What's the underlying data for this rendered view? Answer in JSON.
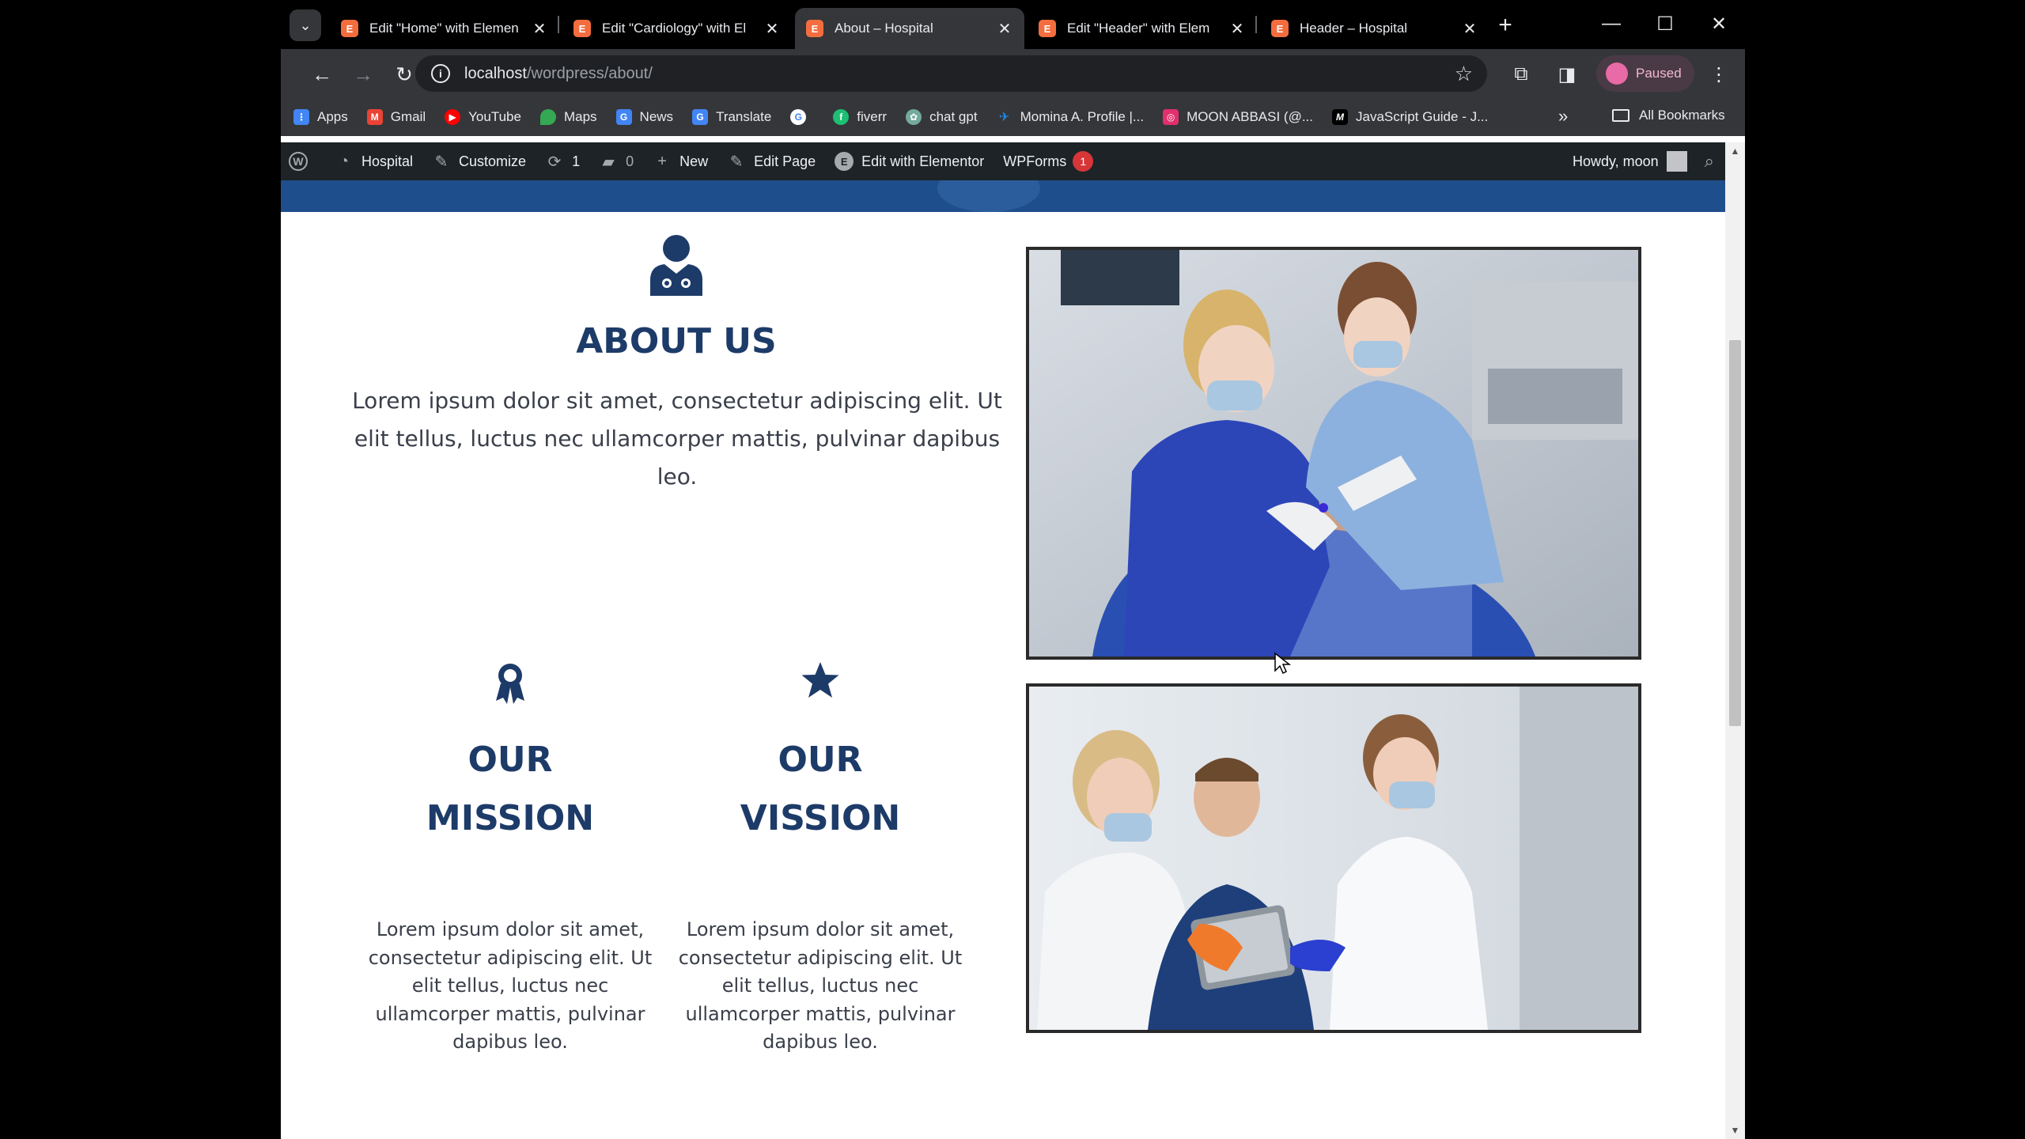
{
  "browser": {
    "tabs": [
      {
        "title": "Edit \"Home\" with Elemen",
        "active": false
      },
      {
        "title": "Edit \"Cardiology\" with El",
        "active": false
      },
      {
        "title": "About – Hospital",
        "active": true
      },
      {
        "title": "Edit \"Header\" with Elem",
        "active": false
      },
      {
        "title": "Header – Hospital",
        "active": false
      }
    ],
    "url_host": "localhost",
    "url_path": "/wordpress/about/",
    "profile_label": "Paused",
    "bookmarks": [
      {
        "label": "Apps",
        "icon": "apps-grid-icon",
        "color": "#4285f4"
      },
      {
        "label": "Gmail",
        "icon": "gmail-icon",
        "color": "#ea4335"
      },
      {
        "label": "YouTube",
        "icon": "youtube-icon",
        "color": "#ff0000"
      },
      {
        "label": "Maps",
        "icon": "maps-icon",
        "color": "#34a853"
      },
      {
        "label": "News",
        "icon": "news-icon",
        "color": "#4285f4"
      },
      {
        "label": "Translate",
        "icon": "translate-icon",
        "color": "#4285f4"
      },
      {
        "label": "",
        "icon": "google-icon",
        "color": "#ffffff"
      },
      {
        "label": "fiverr",
        "icon": "fiverr-icon",
        "color": "#1dbf73"
      },
      {
        "label": "chat gpt",
        "icon": "chatgpt-icon",
        "color": "#74aa9c"
      },
      {
        "label": "Momina A. Profile |...",
        "icon": "upwork-icon",
        "color": "#1e88e5"
      },
      {
        "label": "MOON ABBASI (@...",
        "icon": "instagram-icon",
        "color": "#e1306c"
      },
      {
        "label": "JavaScript Guide - J...",
        "icon": "mdn-icon",
        "color": "#000000"
      }
    ],
    "all_bookmarks_label": "All Bookmarks"
  },
  "adminbar": {
    "site": "Hospital",
    "customize": "Customize",
    "updates": "1",
    "comments": "0",
    "new": "New",
    "edit_page": "Edit Page",
    "edit_elementor": "Edit with Elementor",
    "wpforms": "WPForms",
    "wpforms_count": "1",
    "howdy": "Howdy, moon"
  },
  "content": {
    "about_title": "ABOUT US",
    "about_text": "Lorem ipsum dolor sit amet, consectetur adipiscing elit. Ut elit tellus, luctus nec ullamcorper mattis, pulvinar dapibus leo.",
    "mission_title": "OUR MISSION",
    "mission_text": "Lorem ipsum dolor sit amet, consectetur adipiscing elit. Ut elit tellus, luctus nec ullamcorper mattis, pulvinar dapibus leo.",
    "vision_title": "OUR VISSION",
    "vision_text": "Lorem ipsum dolor sit amet, consectetur adipiscing elit. Ut elit tellus, luctus nec ullamcorper mattis, pulvinar dapibus leo."
  },
  "colors": {
    "heading": "#1d3b68",
    "hero_band": "#1f4e8c",
    "tab_favicon": "#f36d3e",
    "adminbar": "#1d2327"
  }
}
